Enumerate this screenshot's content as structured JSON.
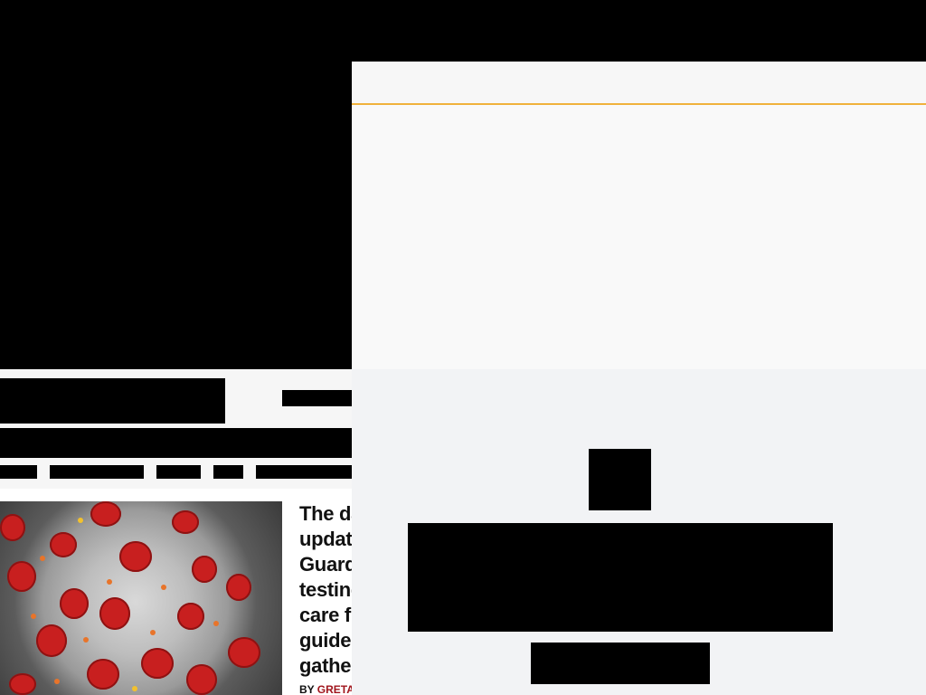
{
  "story": {
    "headline": "The da\nupdat\nGuard\ntesting\ncare f\nguide\ngathe",
    "byline_prefix": "BY",
    "byline_author": "GRETA"
  },
  "colors": {
    "byline_author": "#a0151c",
    "overlay_accent_line": "#f0b23c",
    "virus_spike": "#c81f1f"
  }
}
